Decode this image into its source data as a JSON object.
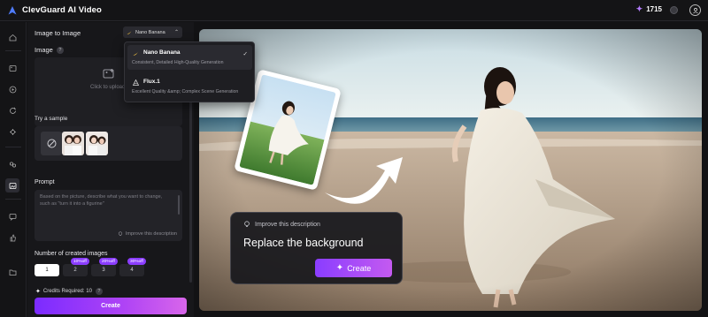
{
  "app": {
    "title": "ClevGuard AI Video",
    "credits": "1715"
  },
  "panel": {
    "mode_label": "Image to Image",
    "model_selected": "Nano Banana",
    "image_label": "Image",
    "upload_text": "Click to upload",
    "sample_label": "Try a sample",
    "prompt_label": "Prompt",
    "prompt_placeholder": "Based on the picture, describe what you want to change, such as \"turn it into a figurine\"",
    "improve_label": "Improve this description",
    "num_label": "Number of created images",
    "counts": [
      {
        "value": "1",
        "badge": ""
      },
      {
        "value": "2",
        "badge": "10%off"
      },
      {
        "value": "3",
        "badge": "20%off"
      },
      {
        "value": "4",
        "badge": "30%off"
      }
    ],
    "selected_count": "1",
    "credits_required": "Credits Required: 10",
    "create_label": "Create"
  },
  "dropdown": {
    "items": [
      {
        "title": "Nano Banana",
        "desc": "Consistent, Detailed High-Quality Generation",
        "selected": true
      },
      {
        "title": "Flux.1",
        "desc": "Excellent Quality &amp; Complex Scene Generation",
        "selected": false
      }
    ]
  },
  "hero": {
    "hint": "Improve this description",
    "text": "Replace the background",
    "create_label": "Create"
  },
  "colors": {
    "accent": "#8b3dff",
    "accent_end": "#d866ea"
  },
  "icons": [
    "logo-icon",
    "spark-icon",
    "user-icon",
    "home-icon",
    "image-icon",
    "video-icon",
    "refresh-icon",
    "tool-icon",
    "swap-icon",
    "image-edit-icon",
    "chat-icon",
    "thumb-icon",
    "folder-icon",
    "upload-icon",
    "no-sample-icon",
    "bulb-icon",
    "check-icon",
    "banana-icon",
    "flux-icon"
  ]
}
